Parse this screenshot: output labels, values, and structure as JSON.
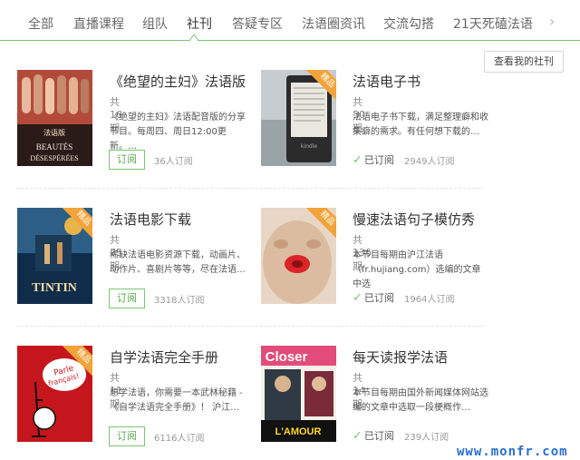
{
  "tabs": [
    {
      "label": "全部"
    },
    {
      "label": "直播课程"
    },
    {
      "label": "组队"
    },
    {
      "label": "社刊",
      "active": true
    },
    {
      "label": "答疑专区"
    },
    {
      "label": "法语圈资讯"
    },
    {
      "label": "交流勾搭"
    },
    {
      "label": "21天死磕法语"
    }
  ],
  "tabs_next_icon": "chevron-right-icon",
  "my_subscriptions_label": "查看我的社刊",
  "cards": [
    {
      "title": "《绝望的主妇》法语版",
      "count": "共16期",
      "desc": "《绝望的主妇》法语配音版的分享节目。每周四、周日12:00更新。…",
      "subscribed": false,
      "action": "订阅",
      "subs": "36人订阅",
      "badge": "",
      "cover_text": "BEAUTÉS DÉSESPÉRÉES",
      "cover_subtext": "法语版"
    },
    {
      "title": "法语电子书",
      "count": "共30期",
      "desc": "法语电子书下载，满足整理癖和收集癖的需求。有任何想下载的…",
      "subscribed": true,
      "action": "已订阅",
      "subs": "2949人订阅",
      "badge": "精品",
      "cover_text": "kindle",
      "cover_subtext": ""
    },
    {
      "title": "法语电影下载",
      "count": "共75期",
      "desc": "稀缺法语电影资源下载，动画片、动作片、喜剧片等等，尽在法语…",
      "subscribed": false,
      "action": "订阅",
      "subs": "3318人订阅",
      "badge": "精品",
      "cover_text": "TINTIN",
      "cover_subtext": ""
    },
    {
      "title": "慢速法语句子模仿秀",
      "count": "共136期",
      "desc": "本节目每期由沪江法语（fr.hujiang.com）选编的文章中选",
      "subscribed": true,
      "action": "已订阅",
      "subs": "1964人订阅",
      "badge": "精品",
      "cover_text": "",
      "cover_subtext": ""
    },
    {
      "title": "自学法语完全手册",
      "count": "共11期",
      "desc": "想学法语，你需要一本武林秘籍 - 《自学法语完全手册》！ 沪江…",
      "subscribed": false,
      "action": "订阅",
      "subs": "6116人订阅",
      "badge": "精品",
      "cover_text": "Parle français!",
      "cover_subtext": ""
    },
    {
      "title": "每天读报学法语",
      "count": "共14期",
      "desc": "本节目每期由国外新闻媒体网站选编的文章中选取一段梗概作…",
      "subscribed": true,
      "action": "已订阅",
      "subs": "239人订阅",
      "badge": "",
      "cover_text": "Closer",
      "cover_subtext": "L'AMOUR"
    }
  ],
  "watermark": "www.monfr.com",
  "colors": {
    "accent": "#7cc576",
    "badge": "#f2a33a",
    "watermark": "#2a6fc9"
  }
}
